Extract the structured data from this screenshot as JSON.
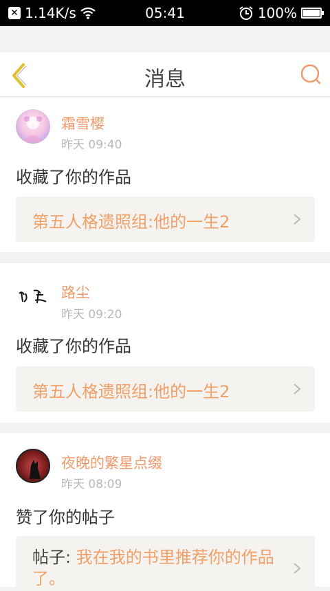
{
  "status_bar": {
    "network_speed": "1.14K/s",
    "time": "05:41",
    "battery": "100%"
  },
  "header": {
    "title": "消息"
  },
  "messages": [
    {
      "username": "霜雪樱",
      "time": "昨天 09:40",
      "action": "收藏了你的作品",
      "work_title": "第五人格遗照组:他的一生2"
    },
    {
      "username": "路尘",
      "time": "昨天 09:20",
      "action": "收藏了你的作品",
      "work_title": "第五人格遗照组:他的一生2"
    },
    {
      "username": "夜晚的繁星点缀",
      "time": "昨天 08:09",
      "action": "赞了你的帖子",
      "post_prefix": "帖子:",
      "post_title": "我在我的书里推荐你的作品了。"
    }
  ],
  "icons": {
    "back": "chevron-left-icon",
    "search": "search-icon",
    "row_arrow": "chevron-right-icon"
  },
  "colors": {
    "accent": "#ef9a6a",
    "back_icon": "#e0c030",
    "time": "#b8b8b8",
    "card_bg": "#f4f3ef"
  }
}
